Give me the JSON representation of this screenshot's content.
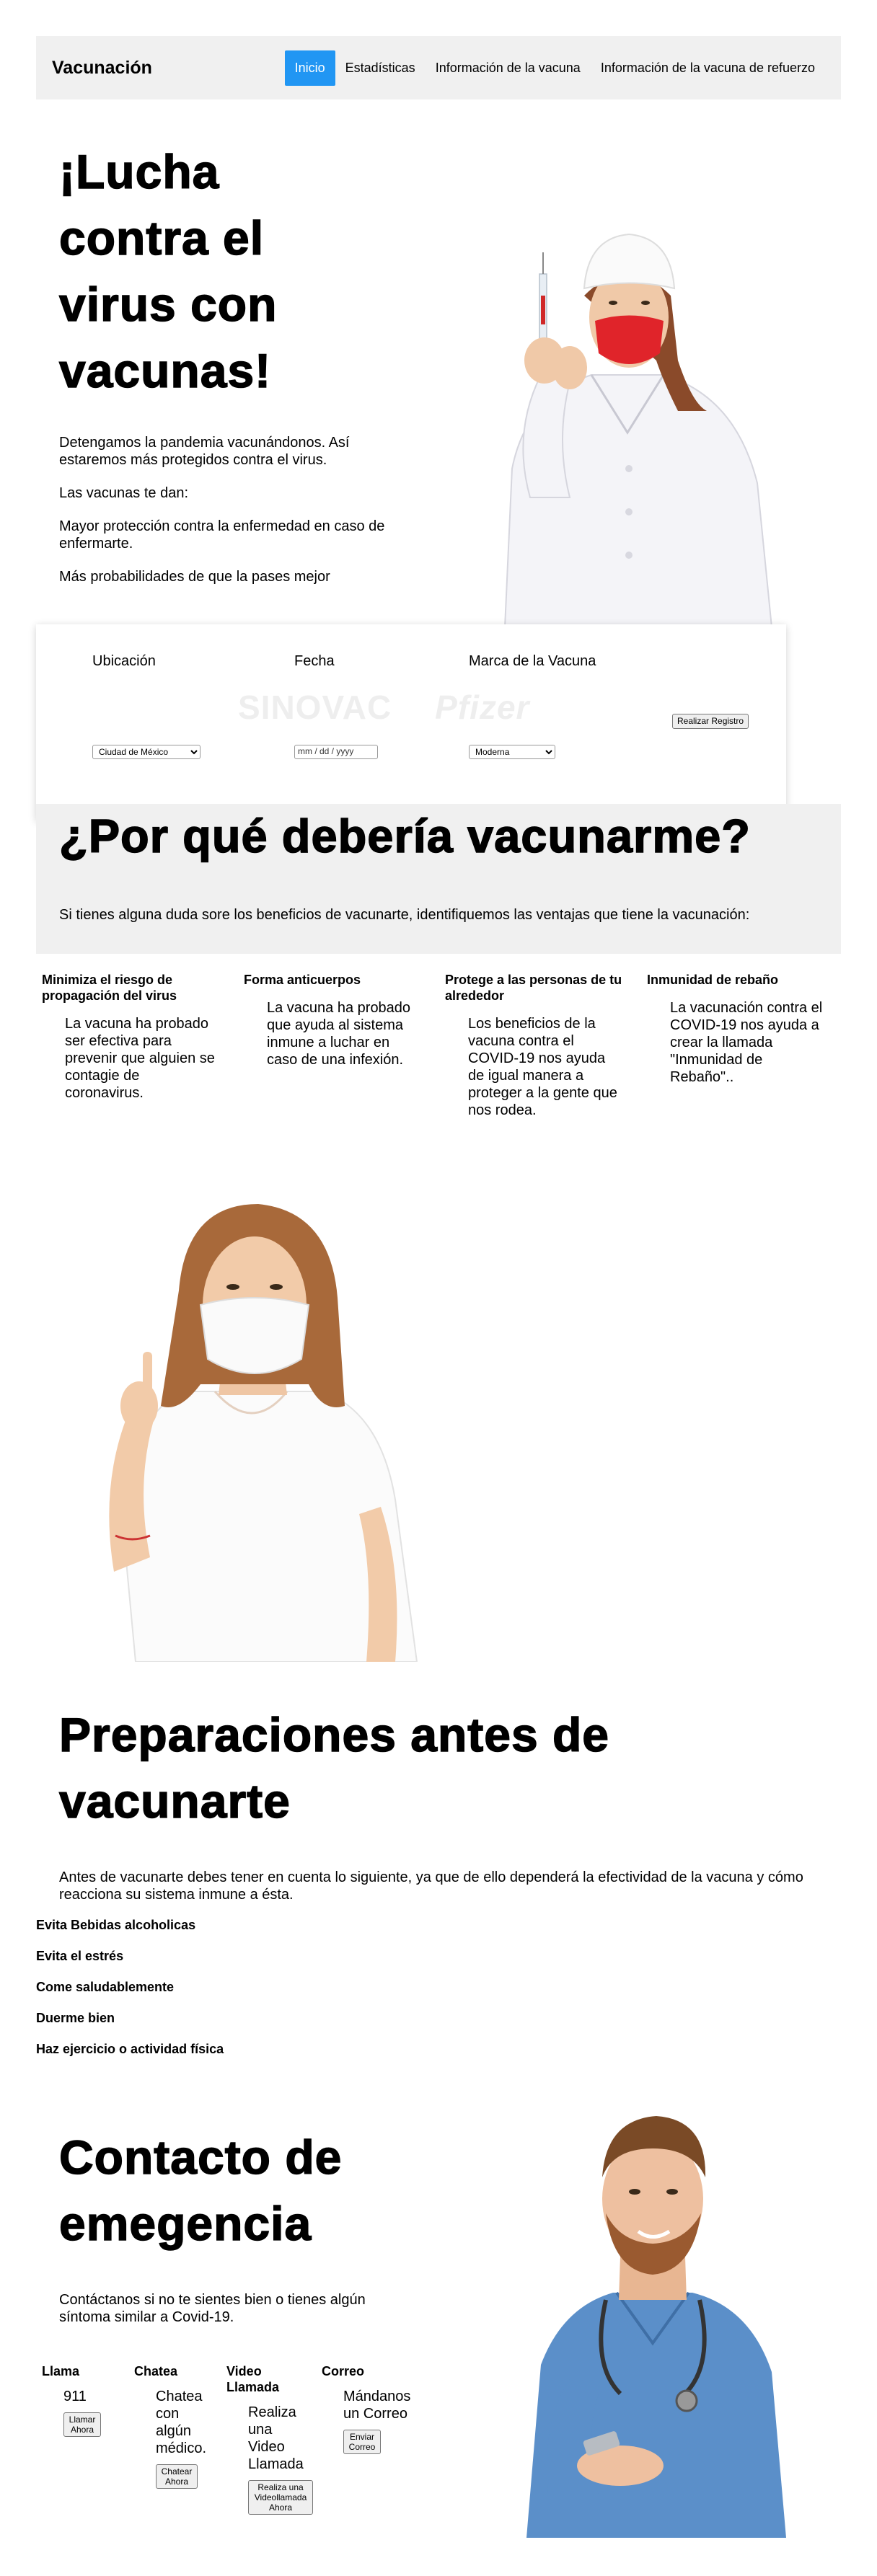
{
  "nav": {
    "brand": "Vacunación",
    "links": [
      "Inicio",
      "Estadísticas",
      "Información de la vacuna",
      "Información de la vacuna de refuerzo"
    ]
  },
  "hero": {
    "title": "¡Lucha contra el virus con vacunas!",
    "p1": "Detengamos la pandemia vacunándonos. Así estaremos más protegidos contra el virus.",
    "p2": "Las vacunas te dan:",
    "p3": "Mayor protección contra la enfermedad en caso de enfermarte.",
    "p4": "Más probabilidades de que la pases mejor"
  },
  "form": {
    "location_label": "Ubicación",
    "location_value": "Ciudad de México",
    "date_label": "Fecha",
    "date_placeholder": "mm / dd / yyyy",
    "brand_label": "Marca de la Vacuna",
    "brand_value": "Moderna",
    "submit_label": "Realizar Registro",
    "logos": [
      "SINOVAC",
      "Pfizer"
    ]
  },
  "why": {
    "title": "¿Por qué debería vacunarme?",
    "subtitle": "Si tienes alguna duda sore los beneficios de vacunarte, identifiquemos las ventajas que tiene la vacunación:",
    "benefits": [
      {
        "title": "Minimiza el riesgo de propagación del virus",
        "text": "La vacuna ha probado ser efectiva para prevenir que alguien se contagie de coronavirus."
      },
      {
        "title": "Forma anticuerpos",
        "text": "La vacuna ha probado que ayuda al sistema inmune a luchar en caso de una infexión."
      },
      {
        "title": "Protege a las personas de tu alrededor",
        "text": "Los beneficios de la vacuna contra el COVID-19 nos ayuda de igual manera a proteger a la gente que nos rodea."
      },
      {
        "title": "Inmunidad de rebaño",
        "text": "La vacunación contra el COVID-19 nos ayuda a crear la llamada \"Inmunidad de Rebaño\".."
      }
    ]
  },
  "prep": {
    "title": "Preparaciones antes de vacunarte",
    "text": "Antes de vacunarte debes tener en cuenta lo siguiente, ya que de ello dependerá la efectividad de la vacuna y cómo reacciona su sistema inmune a ésta.",
    "items": [
      "Evita Bebidas alcoholicas",
      "Evita el estrés",
      "Come saludablemente",
      "Duerme bien",
      "Haz ejercicio o actividad física"
    ]
  },
  "contact": {
    "title": "Contacto de emegencia",
    "text": "Contáctanos si no te sientes bien o tienes algún síntoma similar a Covid-19.",
    "cols": [
      {
        "title": "Llama",
        "text": "911",
        "button": "Llamar Ahora"
      },
      {
        "title": "Chatea",
        "text": "Chatea con algún médico.",
        "button": "Chatear Ahora"
      },
      {
        "title": "Video Llamada",
        "text": "Realiza una Video Llamada",
        "button": "Realiza una Videollamada Ahora"
      },
      {
        "title": "Correo",
        "text": "Mándanos un Correo",
        "button": "Enviar Correo"
      }
    ]
  },
  "colors": {
    "accent": "#2196f3",
    "band": "#f0f0f0"
  }
}
